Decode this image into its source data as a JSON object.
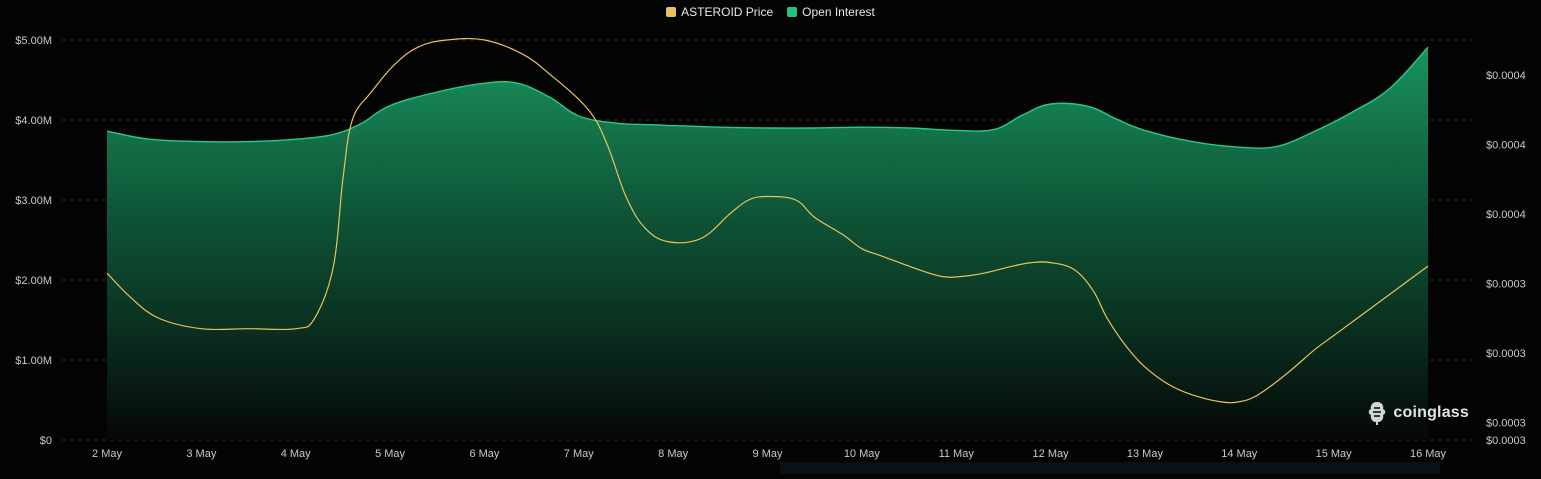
{
  "legend": {
    "price_label": "ASTEROID Price",
    "oi_label": "Open Interest"
  },
  "watermark": {
    "brand": "coinglass"
  },
  "colors": {
    "background": "#040404",
    "price_line": "#e8c35a",
    "price_swatch": "#e8c35a",
    "oi_line": "#27c98a",
    "oi_fill_top": "#1a9a64",
    "oi_fill_bottom": "#050707",
    "oi_swatch": "#22c383",
    "grid": "#2a2a2a",
    "text": "#c9c9c9"
  },
  "chart_data": {
    "type": "area",
    "categories": [
      "2 May",
      "3 May",
      "4 May",
      "5 May",
      "6 May",
      "7 May",
      "8 May",
      "9 May",
      "10 May",
      "11 May",
      "12 May",
      "13 May",
      "14 May",
      "15 May",
      "16 May"
    ],
    "y_left": {
      "ticks": [
        "$0",
        "$1.00M",
        "$2.00M",
        "$3.00M",
        "$4.00M",
        "$5.00M"
      ],
      "tick_values": [
        0,
        1000000,
        2000000,
        3000000,
        4000000,
        5000000
      ],
      "range": [
        0,
        5000000
      ]
    },
    "y_right": {
      "ticks": [
        "$0.0003",
        "$0.0003",
        "$0.0003",
        "$0.0003",
        "$0.0004",
        "$0.0004",
        "$0.0004"
      ],
      "tick_values": [
        0.00027,
        0.000275,
        0.000295,
        0.000315,
        0.000335,
        0.000355,
        0.000375
      ],
      "range": [
        0.00027,
        0.000385
      ]
    },
    "grid": true,
    "legend_position": "top-center",
    "series": [
      {
        "name": "Open Interest",
        "axis": "left",
        "type": "area",
        "x": [
          0,
          0.45,
          1,
          1.5,
          2,
          2.4,
          2.7,
          3,
          3.5,
          4,
          4.35,
          4.7,
          5,
          5.4,
          5.8,
          6,
          6.5,
          7,
          7.5,
          8,
          8.5,
          9,
          9.4,
          9.7,
          10,
          10.4,
          10.7,
          11,
          11.5,
          12,
          12.4,
          12.8,
          13.2,
          13.6,
          14
        ],
        "values": [
          3860000,
          3760000,
          3730000,
          3730000,
          3760000,
          3820000,
          3960000,
          4180000,
          4350000,
          4460000,
          4460000,
          4280000,
          4050000,
          3960000,
          3940000,
          3930000,
          3910000,
          3900000,
          3900000,
          3910000,
          3900000,
          3870000,
          3880000,
          4060000,
          4200000,
          4170000,
          4010000,
          3870000,
          3730000,
          3660000,
          3670000,
          3860000,
          4100000,
          4400000,
          4910000
        ]
      },
      {
        "name": "ASTEROID Price",
        "axis": "right",
        "type": "line",
        "x": [
          0,
          0.25,
          0.55,
          1,
          1.5,
          2,
          2.2,
          2.4,
          2.5,
          2.6,
          2.8,
          3.05,
          3.3,
          3.6,
          4,
          4.4,
          4.7,
          5.1,
          5.3,
          5.5,
          5.7,
          5.95,
          6.3,
          6.6,
          6.8,
          7,
          7.3,
          7.5,
          7.8,
          8,
          8.2,
          8.6,
          8.85,
          9.05,
          9.3,
          9.6,
          9.8,
          10,
          10.25,
          10.45,
          10.6,
          10.8,
          11,
          11.25,
          11.5,
          11.8,
          12,
          12.2,
          12.5,
          12.8,
          13,
          13.2,
          13.5,
          13.8,
          14
        ],
        "values": [
          0.000318,
          0.000311,
          0.000305,
          0.000302,
          0.000302,
          0.000302,
          0.000305,
          0.00032,
          0.000345,
          0.000362,
          0.00037,
          0.000378,
          0.000383,
          0.000385,
          0.000385,
          0.000381,
          0.000375,
          0.000365,
          0.000355,
          0.00034,
          0.000331,
          0.000327,
          0.000328,
          0.000335,
          0.000339,
          0.00034,
          0.000339,
          0.000334,
          0.000329,
          0.000325,
          0.000323,
          0.000319,
          0.000317,
          0.000317,
          0.000318,
          0.00032,
          0.000321,
          0.000321,
          0.000319,
          0.000313,
          0.000305,
          0.000297,
          0.000291,
          0.000286,
          0.000283,
          0.000281,
          0.000281,
          0.000283,
          0.000289,
          0.000296,
          0.0003,
          0.000304,
          0.00031,
          0.000316,
          0.00032
        ]
      }
    ]
  }
}
